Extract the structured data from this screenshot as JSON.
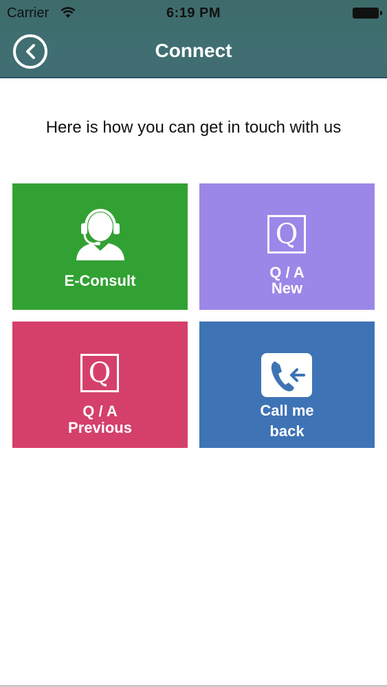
{
  "status_bar": {
    "carrier": "Carrier",
    "time": "6:19 PM"
  },
  "header": {
    "title": "Connect"
  },
  "subtitle": "Here is how you can get in touch with us",
  "tiles": {
    "econsult": {
      "label": "E-Consult",
      "icon": "headset-agent-icon",
      "color": "#32a133"
    },
    "qa_new": {
      "line1": "Q / A",
      "line2": "New",
      "icon_letter": "Q",
      "icon": "q-box-icon",
      "color": "#9b87e8"
    },
    "qa_previous": {
      "line1": "Q / A",
      "line2": "Previous",
      "icon_letter": "Q",
      "icon": "q-box-icon",
      "color": "#d5406b"
    },
    "callback": {
      "line1": "Call me",
      "line2": "back",
      "icon": "phone-incoming-icon",
      "color": "#3e73b5"
    }
  }
}
